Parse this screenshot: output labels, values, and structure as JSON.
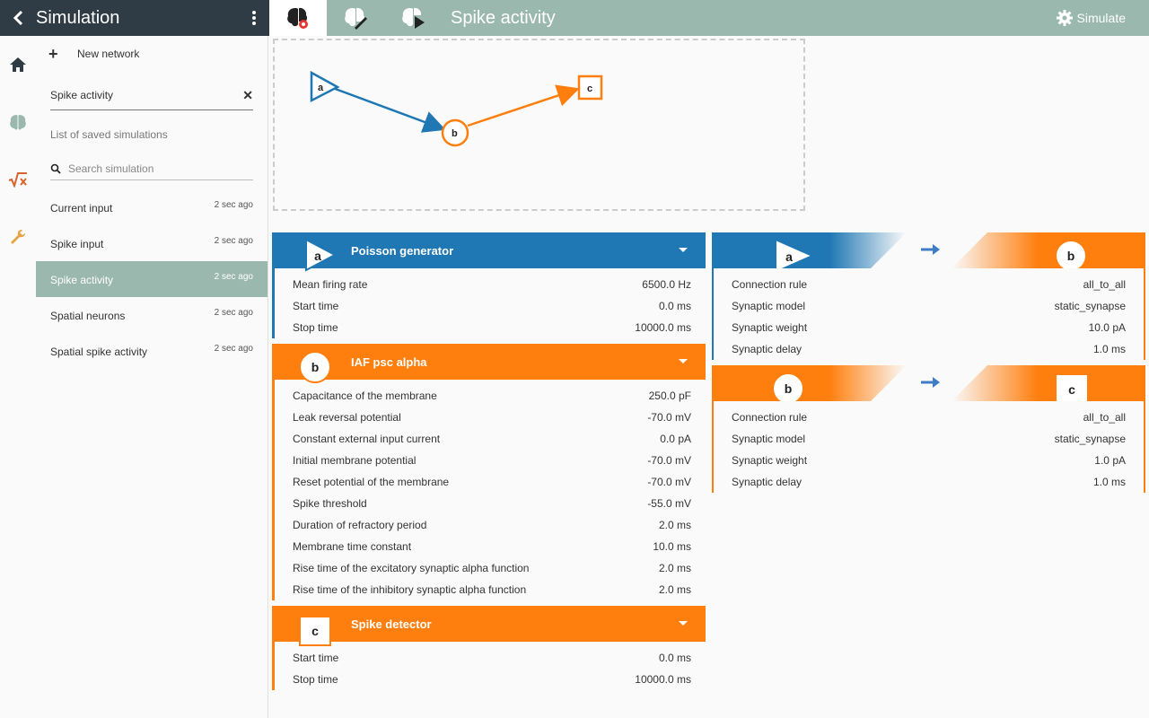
{
  "app": {
    "title": "Simulation"
  },
  "topbar": {
    "view_title": "Spike activity",
    "simulate_label": "Simulate"
  },
  "drawer": {
    "new_network_label": "New network",
    "name_value": "Spike activity",
    "saved_heading": "List of saved simulations",
    "search_placeholder": "Search simulation",
    "items": [
      {
        "name": "Current input",
        "time": "2 sec ago"
      },
      {
        "name": "Spike input",
        "time": "2 sec ago"
      },
      {
        "name": "Spike activity",
        "time": "2 sec ago"
      },
      {
        "name": "Spatial neurons",
        "time": "2 sec ago"
      },
      {
        "name": "Spatial spike activity",
        "time": "2 sec ago"
      }
    ]
  },
  "graph": {
    "nodes": {
      "a": "a",
      "b": "b",
      "c": "c"
    }
  },
  "nodes": [
    {
      "label": "a",
      "title": "Poisson generator",
      "params": [
        {
          "label": "Mean firing rate",
          "value": "6500.0  Hz"
        },
        {
          "label": "Start time",
          "value": "0.0 ms"
        },
        {
          "label": "Stop time",
          "value": "10000.0 ms"
        }
      ]
    },
    {
      "label": "b",
      "title": "IAF psc alpha",
      "params": [
        {
          "label": "Capacitance of the membrane",
          "value": "250.0  pF"
        },
        {
          "label": "Leak reversal potential",
          "value": "-70.0 mV"
        },
        {
          "label": "Constant external input current",
          "value": "0.0  pA"
        },
        {
          "label": "Initial membrane potential",
          "value": "-70.0 mV"
        },
        {
          "label": "Reset potential of the membrane",
          "value": "-70.0 mV"
        },
        {
          "label": "Spike threshold",
          "value": "-55.0 mV"
        },
        {
          "label": "Duration of refractory period",
          "value": "2.0 ms"
        },
        {
          "label": "Membrane time constant",
          "value": "10.0 ms"
        },
        {
          "label": "Rise time of the excitatory synaptic alpha function",
          "value": "2.0 ms"
        },
        {
          "label": "Rise time of the inhibitory synaptic alpha function",
          "value": "2.0 ms"
        }
      ]
    },
    {
      "label": "c",
      "title": "Spike detector",
      "params": [
        {
          "label": "Start time",
          "value": "0.0 ms"
        },
        {
          "label": "Stop time",
          "value": "10000.0 ms"
        }
      ]
    }
  ],
  "connections": [
    {
      "source": "a",
      "target": "b",
      "params": [
        {
          "label": "Connection rule",
          "value": "all_to_all"
        },
        {
          "label": "Synaptic model",
          "value": "static_synapse"
        },
        {
          "label": "Synaptic weight",
          "value": "10.0  pA"
        },
        {
          "label": "Synaptic delay",
          "value": "1.0 ms"
        }
      ]
    },
    {
      "source": "b",
      "target": "c",
      "params": [
        {
          "label": "Connection rule",
          "value": "all_to_all"
        },
        {
          "label": "Synaptic model",
          "value": "static_synapse"
        },
        {
          "label": "Synaptic weight",
          "value": "1.0  pA"
        },
        {
          "label": "Synaptic delay",
          "value": "1.0 ms"
        }
      ]
    }
  ],
  "colors": {
    "blue": "#1f77b4",
    "orange": "#ff7f0e",
    "accent": "#9bb8ae",
    "header": "#2f3c45"
  },
  "icons": [
    "back-icon",
    "more-vert-icon",
    "brain-view-icon",
    "brain-edit-icon",
    "brain-play-icon",
    "gear-icon",
    "home-icon",
    "brain-icon",
    "sqrt-icon",
    "wrench-icon",
    "plus-icon",
    "close-icon",
    "search-icon",
    "arrow-right-icon"
  ]
}
